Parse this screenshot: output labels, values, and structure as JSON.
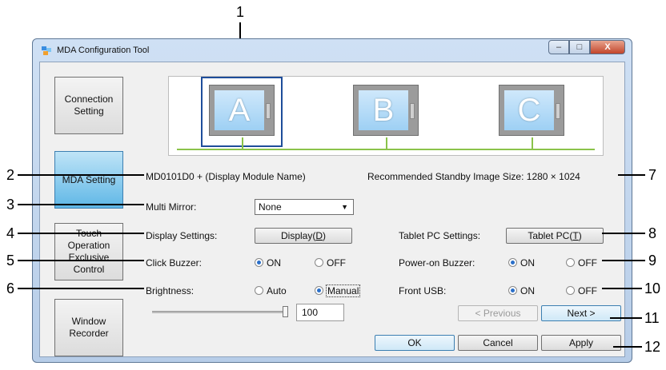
{
  "window": {
    "title": "MDA Configuration Tool",
    "min_glyph": "–",
    "max_glyph": "□",
    "close_glyph": "X"
  },
  "nav": [
    {
      "label": "Connection\nSetting",
      "active": false
    },
    {
      "label": "MDA Setting",
      "active": true
    },
    {
      "label": "Touch\nOperation\nExclusive\nControl",
      "active": false
    },
    {
      "label": "Window\nRecorder",
      "active": false
    }
  ],
  "monitors": [
    "A",
    "B",
    "C"
  ],
  "model": {
    "prefix": "MD0101D0 + ",
    "name": "(Display Module Name)"
  },
  "standby": "Recommended Standby Image Size: 1280 × 1024",
  "multi_mirror": {
    "label": "Multi Mirror:",
    "value": "None"
  },
  "display_settings": {
    "label": "Display Settings:",
    "button_pre": "Display(",
    "button_key": "D",
    "button_post": ")"
  },
  "tablet": {
    "label": "Tablet PC Settings:",
    "button_pre": "Tablet PC(",
    "button_key": "T",
    "button_post": ")"
  },
  "click_buzzer": {
    "label": "Click Buzzer:",
    "on": "ON",
    "off": "OFF",
    "selected": "ON"
  },
  "power_buzzer": {
    "label": "Power-on Buzzer:",
    "on": "ON",
    "off": "OFF",
    "selected": "ON"
  },
  "brightness": {
    "label": "Brightness:",
    "auto": "Auto",
    "manual": "Manual",
    "selected": "Manual",
    "value": "100",
    "level": 1.0
  },
  "front_usb": {
    "label": "Front USB:",
    "on": "ON",
    "off": "OFF",
    "selected": "ON"
  },
  "buttons": {
    "previous": "< Previous",
    "next": "Next >",
    "ok": "OK",
    "cancel": "Cancel",
    "apply": "Apply"
  },
  "callouts": [
    "1",
    "2",
    "3",
    "4",
    "5",
    "6",
    "7",
    "8",
    "9",
    "10",
    "11",
    "12"
  ]
}
